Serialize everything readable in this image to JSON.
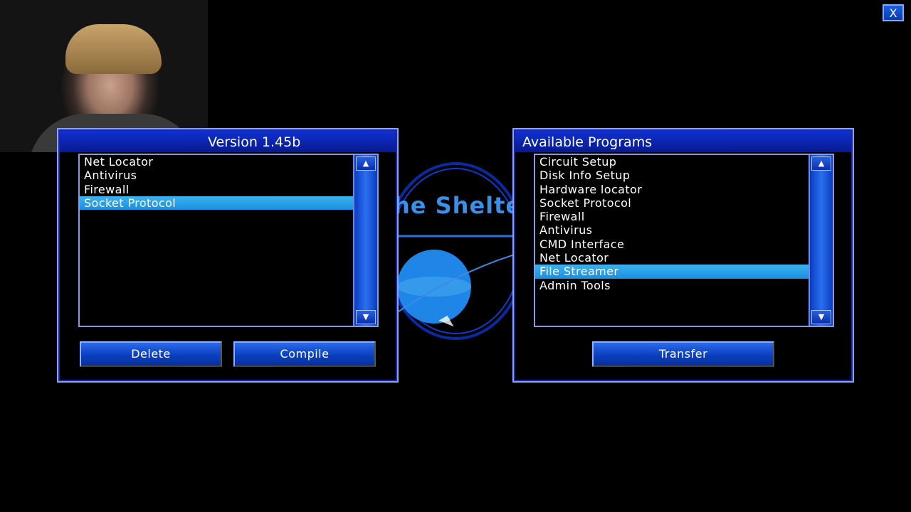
{
  "window": {
    "close_label": "X"
  },
  "background_logo": {
    "text": "he Shelte"
  },
  "left_panel": {
    "title": "Version 1.45b",
    "items": [
      "Net Locator",
      "Antivirus",
      "Firewall",
      "Socket Protocol"
    ],
    "selected_index": 3,
    "delete_label": "Delete",
    "compile_label": "Compile",
    "scroll_up_icon": "▲",
    "scroll_down_icon": "▼"
  },
  "right_panel": {
    "title": "Available Programs",
    "items": [
      "Circuit Setup",
      "Disk Info Setup",
      "Hardware locator",
      "Socket Protocol",
      "Firewall",
      "Antivirus",
      "CMD Interface",
      "Net Locator",
      "File Streamer",
      "Admin Tools"
    ],
    "selected_index": 8,
    "transfer_label": "Transfer",
    "scroll_up_icon": "▲",
    "scroll_down_icon": "▼"
  },
  "colors": {
    "panel_header": "#1030d0",
    "selection": "#2aa0ea",
    "panel_border": "#8aa0ff"
  }
}
